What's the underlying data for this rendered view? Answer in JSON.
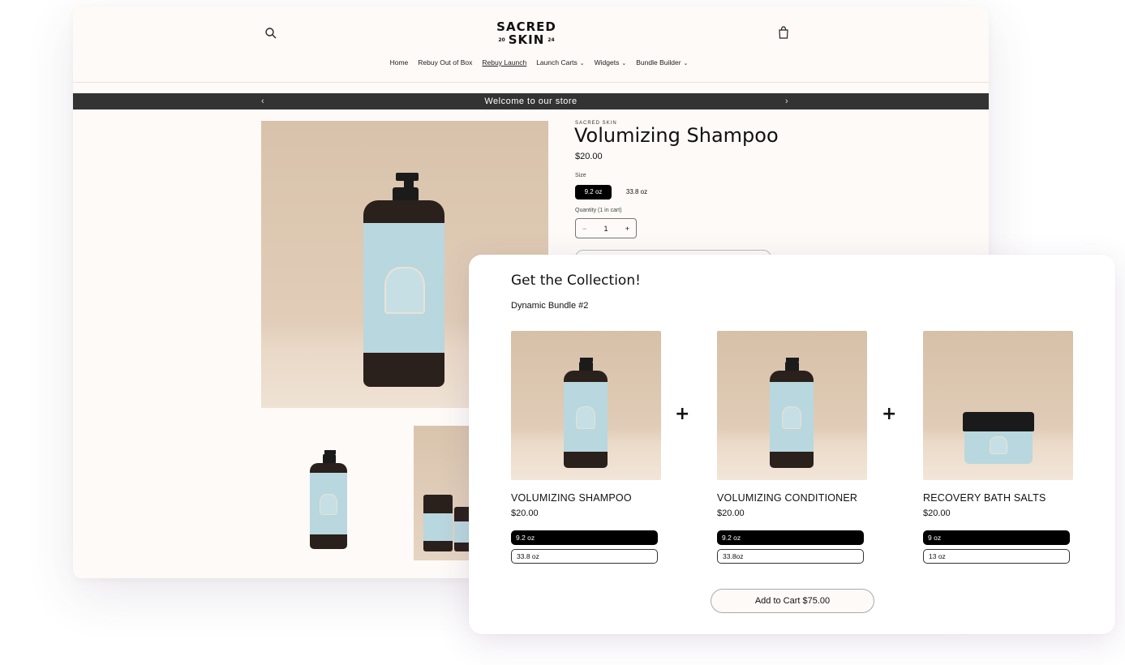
{
  "store": {
    "logo_line1": "SACRED",
    "logo_line2": "SKIN",
    "logo_year_left": "20",
    "logo_year_right": "24",
    "nav": [
      {
        "label": "Home",
        "dropdown": false
      },
      {
        "label": "Rebuy Out of Box",
        "dropdown": false
      },
      {
        "label": "Rebuy Launch",
        "dropdown": false,
        "active": true
      },
      {
        "label": "Launch Carts",
        "dropdown": true
      },
      {
        "label": "Widgets",
        "dropdown": true
      },
      {
        "label": "Bundle Builder",
        "dropdown": true
      }
    ],
    "announcement": "Welcome to our store",
    "prev_arrow": "‹",
    "next_arrow": "›"
  },
  "product": {
    "vendor": "SACRED SKIN",
    "title": "Volumizing Shampoo",
    "price": "$20.00",
    "size_label": "Size",
    "sizes": [
      "9.2 oz",
      "33.8 oz"
    ],
    "selected_size": "9.2 oz",
    "quantity_label": "Quantity (1 in cart)",
    "quantity": "1",
    "minus": "−",
    "plus": "+"
  },
  "bundle": {
    "title": "Get the Collection!",
    "subtitle": "Dynamic Bundle #2",
    "items": [
      {
        "name": "VOLUMIZING SHAMPOO",
        "price": "$20.00",
        "options": [
          "9.2 oz",
          "33.8 oz"
        ],
        "selected": 0
      },
      {
        "name": "VOLUMIZING CONDITIONER",
        "price": "$20.00",
        "options": [
          "9.2 oz",
          "33.8oz"
        ],
        "selected": 0
      },
      {
        "name": "RECOVERY BATH SALTS",
        "price": "$20.00",
        "options": [
          "9 oz",
          "13 oz"
        ],
        "selected": 0
      }
    ],
    "plus_sign": "+",
    "add_to_cart": "Add to Cart $75.00"
  },
  "colors": {
    "store_bg": "#fdfaf7",
    "announcement_bg": "#333333",
    "selected_option_bg": "#000000",
    "label_blue": "#b9d7de",
    "product_bg": "#d8c2ab"
  },
  "icons": {
    "search": "search-icon",
    "cart": "cart-icon",
    "chevron": "chevron-down-icon"
  }
}
